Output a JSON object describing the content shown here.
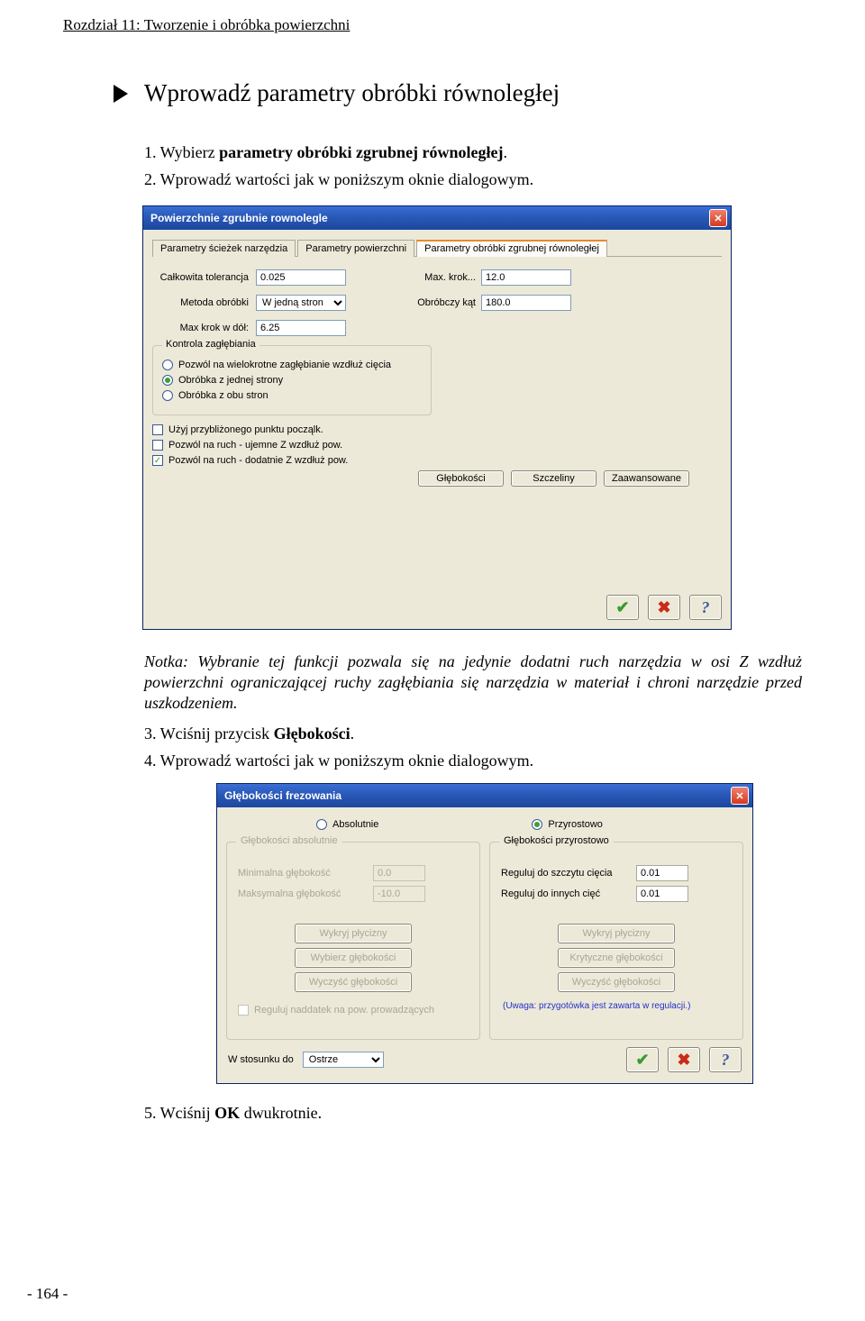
{
  "chapter_header": "Rozdział 11: Tworzenie i obróbka powierzchni",
  "section_title": "Wprowadź parametry obróbki równoległej",
  "step1_prefix": "1. Wybierz ",
  "step1_bold": "parametry obróbki zgrubnej równoległej",
  "step1_suffix": ".",
  "step2": "2. Wprowadź wartości jak w poniższym oknie dialogowym.",
  "note": "Notka: Wybranie tej funkcji pozwala się na jedynie dodatni ruch narzędzia w osi Z wzdłuż powierzchni ograniczającej ruchy zagłębiania się narzędzia w materiał i chroni narzędzie przed uszkodzeniem.",
  "step3_prefix": "3. Wciśnij przycisk ",
  "step3_bold": "Głębokości",
  "step3_suffix": ".",
  "step4": "4. Wprowadź wartości jak w poniższym oknie dialogowym.",
  "step5_prefix": "5. Wciśnij ",
  "step5_bold": "OK",
  "step5_suffix": " dwukrotnie.",
  "page_num": "- 164 -",
  "dialog1": {
    "title": "Powierzchnie zgrubnie rownolegle",
    "tabs": [
      "Parametry ścieżek narzędzia",
      "Parametry powierzchni",
      "Parametry obróbki zgrubnej równoległej"
    ],
    "fields": {
      "tol_label": "Całkowita tolerancja",
      "tol_value": "0.025",
      "maxkrok_label": "Max. krok...",
      "maxkrok_value": "12.0",
      "metoda_label": "Metoda obróbki",
      "metoda_value": "W jedną stron",
      "kat_label": "Obróbczy kąt",
      "kat_value": "180.0",
      "maxdol_label": "Max krok w dół:",
      "maxdol_value": "6.25"
    },
    "fieldset_legend": "Kontrola zagłębiania",
    "radios": [
      "Pozwól na wielokrotne zagłębianie wzdłuż cięcia",
      "Obróbka z jednej strony",
      "Obróbka z obu stron"
    ],
    "checks": [
      "Użyj przybliżonego punktu począlk.",
      "Pozwól na ruch - ujemne Z wzdłuż pow.",
      "Pozwól na ruch - dodatnie Z wzdłuż pow."
    ],
    "buttons": [
      "Głębokości",
      "Szczeliny",
      "Zaawansowane"
    ]
  },
  "dialog2": {
    "title": "Głębokości frezowania",
    "mode_abs": "Absolutnie",
    "mode_incr": "Przyrostowo",
    "left": {
      "legend": "Głębokości absolutnie",
      "min_lbl": "Minimalna głębokość",
      "min_val": "0.0",
      "max_lbl": "Maksymalna głębokość",
      "max_val": "-10.0",
      "btn1": "Wykryj płycizny",
      "btn2": "Wybierz głębokości",
      "btn3": "Wyczyść głębokości",
      "chk": "Reguluj naddatek na pow. prowadzących"
    },
    "right": {
      "legend": "Głębokości przyrostowo",
      "a_lbl": "Reguluj do szczytu cięcia",
      "a_val": "0.01",
      "b_lbl": "Reguluj do innych cięć",
      "b_val": "0.01",
      "btn1": "Wykryj płycizny",
      "btn2": "Krytyczne głębokości",
      "btn3": "Wyczyść głębokości",
      "note": "(Uwaga: przygotówka jest zawarta w regulacji.)"
    },
    "bottom_lbl": "W stosunku do",
    "bottom_sel": "Ostrze"
  }
}
